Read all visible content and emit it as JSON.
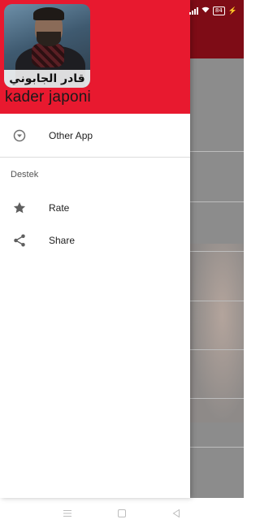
{
  "status_bar": {
    "battery": "84"
  },
  "drawer": {
    "header": {
      "avatar_caption": "قادر الجابوني",
      "app_name": "kader japoni"
    },
    "items": [
      {
        "label": "Other App",
        "icon": "chevron-down-circle-icon"
      }
    ],
    "section_title": "Destek",
    "section_items": [
      {
        "label": "Rate",
        "icon": "star-icon"
      },
      {
        "label": "Share",
        "icon": "share-icon"
      }
    ]
  },
  "colors": {
    "header_red": "#e8192f",
    "toolbar_dark_red": "#7e0c16"
  },
  "nav_bar": {
    "buttons": [
      "menu-icon",
      "home-icon",
      "back-icon"
    ]
  }
}
